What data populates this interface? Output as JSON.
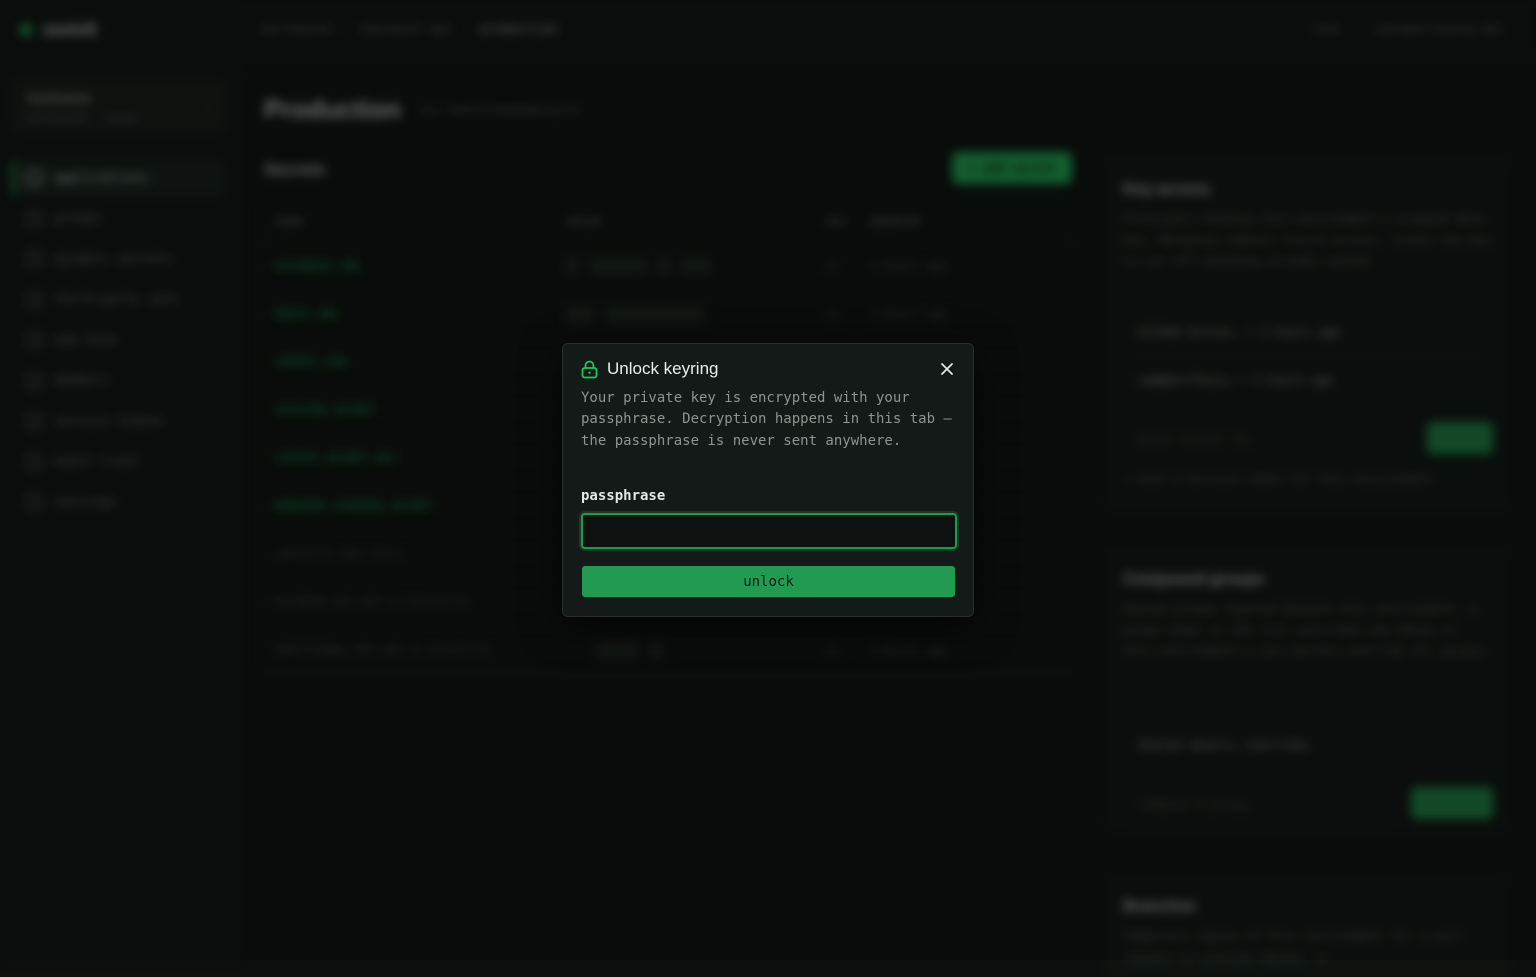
{
  "background": {
    "brand": "seeloft",
    "org": {
      "name": "Northwind",
      "sub": "northwind · owner"
    },
    "nav": [
      {
        "label": "applications",
        "active": true,
        "icon": "home-icon"
      },
      {
        "label": "groups",
        "icon": "layers-icon"
      },
      {
        "label": "dynamic secrets",
        "icon": "bolt-icon"
      },
      {
        "label": "third-party sync",
        "icon": "sync-icon"
      },
      {
        "label": "web hook",
        "icon": "link-icon"
      },
      {
        "label": "members",
        "icon": "users-icon"
      },
      {
        "label": "service tokens",
        "icon": "key-icon"
      },
      {
        "label": "audit trail",
        "icon": "clipboard-icon"
      },
      {
        "label": "settings",
        "icon": "gear-icon"
      }
    ],
    "breadcrumbs": [
      "northwind",
      "checkout-api",
      "production"
    ],
    "topbar_right": [
      "lock",
      "user@northwind.dev"
    ],
    "page_title": "Production",
    "env_id": "env_7e0f61fe9a8a0b1aa2f0",
    "secrets": {
      "title": "Secrets",
      "add_label": "+ add secret",
      "headers": {
        "name": "name",
        "value": "value",
        "ver": "ver",
        "updated": "updated"
      },
      "rows": [
        {
          "name": "DATABASE_URL",
          "ver": "v1",
          "updated": "3 hours ago"
        },
        {
          "name": "REDIS_URL",
          "ver": "v1",
          "updated": "3 hours ago"
        },
        {
          "name": "SENTRY_DSN",
          "ver": "",
          "updated": ""
        },
        {
          "name": "SESSION_SECRET",
          "ver": "",
          "updated": ""
        },
        {
          "name": "STRIPE_SECRET_KEY",
          "ver": "",
          "updated": ""
        },
        {
          "name": "WEBHOOK_SIGNING_SECRET",
          "ver": "",
          "updated": ""
        },
        {
          "name": "identify new users",
          "ver": "",
          "updated": "",
          "dim": true
        },
        {
          "name": "DATADOG_API_KEY @ overwrite",
          "ver": "",
          "updated": "",
          "dim": true
        },
        {
          "name": "ADDITIONAL_API_KEY @ overwrite",
          "ver": "v1",
          "updated": "3 hours ago",
          "dim": true
        }
      ]
    },
    "key_access": {
      "title": "Key access",
      "text": "Principals holding this environment's wrapped data key. Revoking removes future access; rotate the key to cut off anything already cached.",
      "rows": [
        "GitHub Action, • 3 hours ago",
        "sam@northwin… • 3 hours ago"
      ],
      "input_placeholder": "grant access to…",
      "button": "grant",
      "note": "+ mint a service token for this environment"
    },
    "composed_groups": {
      "title": "Composed groups",
      "text": "Shared groups layered beneath this environment. A group lower in the list overrides one above it. This environment's own secrets override all groups.",
      "row": "Shared observ… override…",
      "input_placeholder": "compose a group…",
      "button": "compose"
    },
    "branches": {
      "title": "Branches",
      "text": "Temporary copies of this environment for a pull request or preview deploy. A"
    }
  },
  "modal": {
    "title": "Unlock keyring",
    "description": "Your private key is encrypted with your passphrase. Decryption happens in this tab — the passphrase is never sent anywhere.",
    "field_label": "passphrase",
    "input_value": "",
    "unlock_label": "unlock",
    "accent": "#22c55e"
  }
}
